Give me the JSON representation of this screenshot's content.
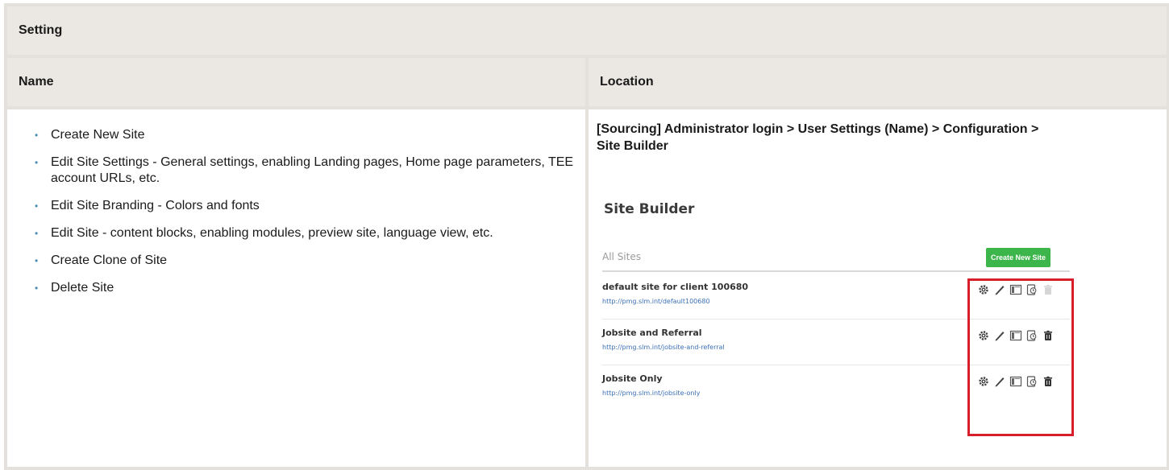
{
  "table": {
    "setting_header": "Setting",
    "name_header": "Name",
    "location_header": "Location"
  },
  "settings_list": [
    "Create New Site",
    "Edit Site Settings - General settings, enabling Landing pages, Home page parameters, TEE account URLs, etc.",
    "Edit Site Branding - Colors and fonts",
    "Edit Site - content blocks, enabling modules, preview site, language view, etc.",
    "Create Clone of Site",
    "Delete Site"
  ],
  "location_text": "[Sourcing] Administrator login > User Settings (Name) > Configuration > Site Builder",
  "site_builder": {
    "title": "Site Builder",
    "all_sites_label": "All Sites",
    "create_button_label": "Create New Site",
    "sites": [
      {
        "name": "default site for client 100680",
        "url": "http://pmg.slm.int/default100680",
        "delete_enabled": false
      },
      {
        "name": "Jobsite and Referral",
        "url": "http://pmg.slm.int/jobsite-and-referral",
        "delete_enabled": true
      },
      {
        "name": "Jobsite Only",
        "url": "http://pmg.slm.int/jobsite-only",
        "delete_enabled": true
      }
    ],
    "row_icons": [
      "gear-icon",
      "pencil-icon",
      "layout-icon",
      "clone-icon",
      "trash-icon"
    ],
    "colors": {
      "create_button": "#3cb54a",
      "highlight": "#d81e2a",
      "link": "#3b6fb6"
    }
  }
}
